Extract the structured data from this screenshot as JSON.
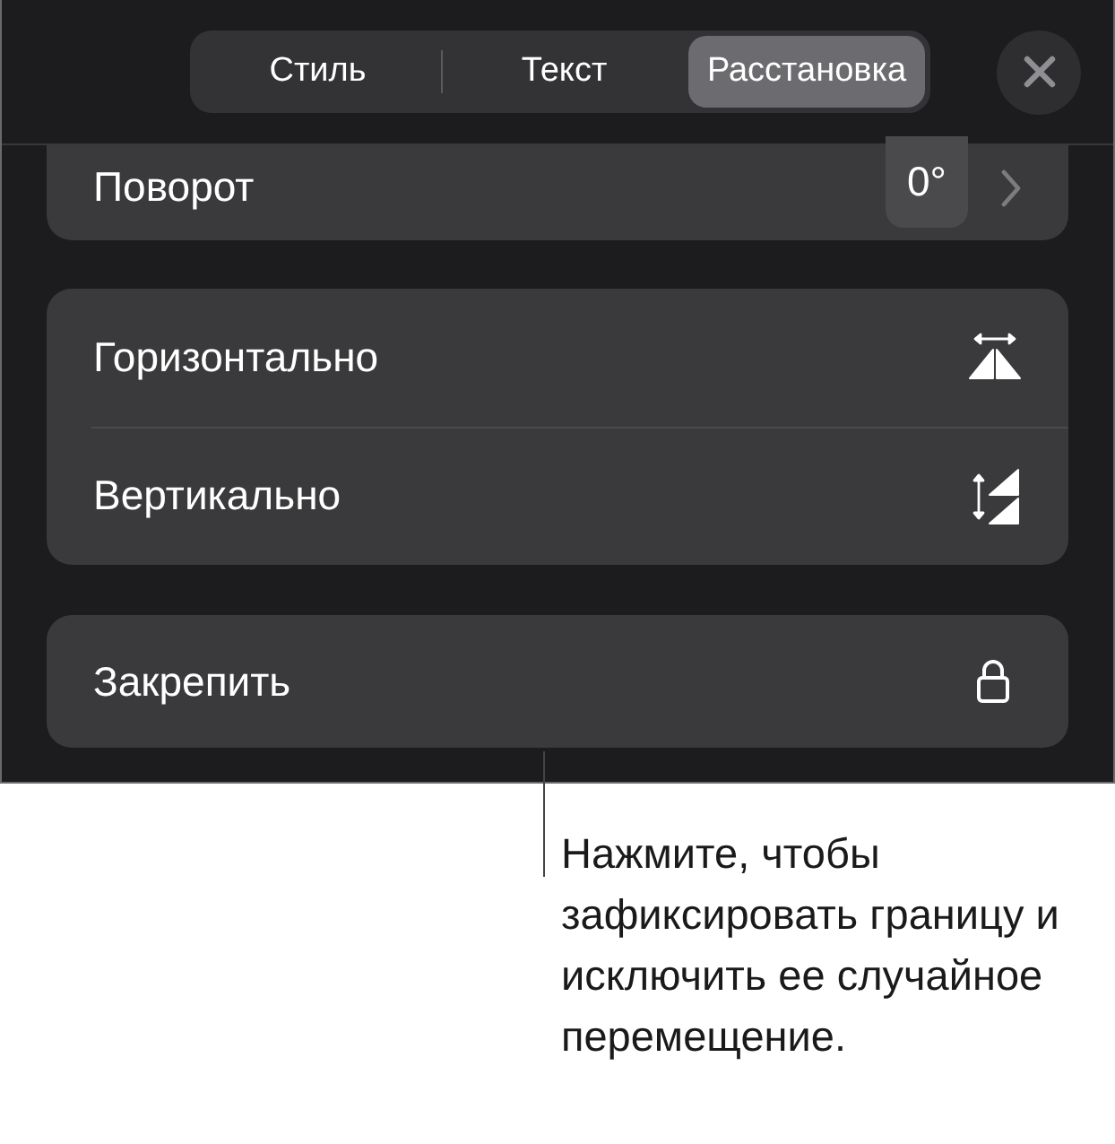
{
  "tabs": [
    {
      "label": "Стиль",
      "selected": false
    },
    {
      "label": "Текст",
      "selected": false
    },
    {
      "label": "Расстановка",
      "selected": true
    }
  ],
  "rotation": {
    "label": "Поворот",
    "value": "0°"
  },
  "flip_rows": [
    {
      "label": "Горизонтально",
      "kind": "horizontal"
    },
    {
      "label": "Вертикально",
      "kind": "vertical"
    }
  ],
  "lock": {
    "label": "Закрепить"
  },
  "callout": "Нажмите, чтобы зафиксировать границу и исключить ее случайное перемещение."
}
